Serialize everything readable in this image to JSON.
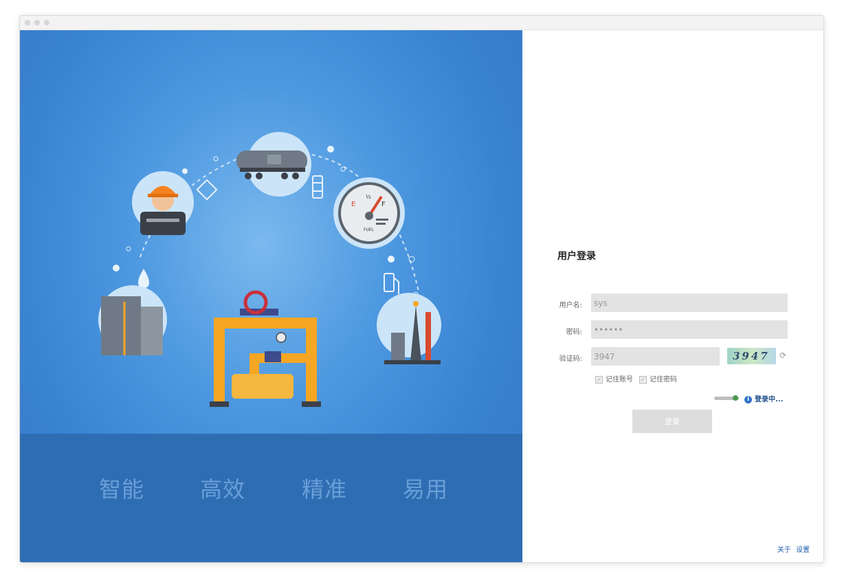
{
  "slogans": [
    "智能",
    "高效",
    "精准",
    "易用"
  ],
  "illustration": {
    "icons": [
      "oil-tank-icon",
      "worker-icon",
      "tank-car-icon",
      "fuel-gauge-icon",
      "refinery-icon",
      "pipeline-valve-icon"
    ],
    "gauge": {
      "e": "E",
      "half": "½",
      "f": "F",
      "fuel": "FUEL"
    }
  },
  "login": {
    "title": "用户登录",
    "username_label": "用户名:",
    "username_value": "sys",
    "password_label": "密码:",
    "password_value": "••••••",
    "captcha_label": "验证码:",
    "captcha_value": "3947",
    "captcha_image_text": "3947",
    "remember_account": "记住账号",
    "remember_password": "记住密码",
    "status_text": "登录中...",
    "login_button": "登录"
  },
  "footer": {
    "about": "关于",
    "settings": "设置"
  },
  "colors": {
    "blue_bg": "#3a84d2",
    "footer_band": "#2f6db3",
    "link": "#1f5fb0"
  }
}
